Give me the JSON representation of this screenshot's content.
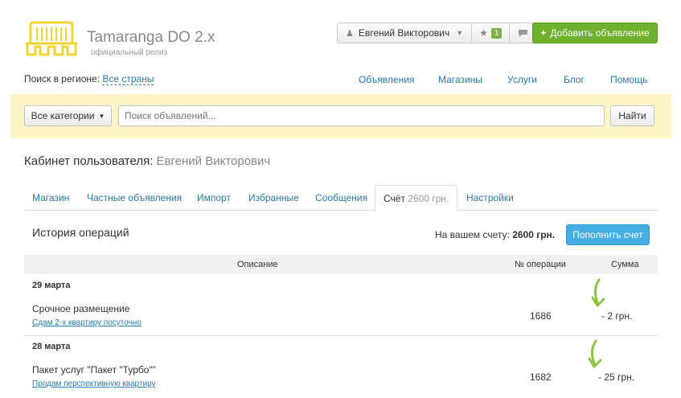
{
  "brand": {
    "title": "Tamaranga DO 2.x",
    "subtitle": "официальный релиз",
    "logo_icon": "turnstile-logo-icon",
    "logo_color": "#f2d533"
  },
  "header": {
    "user_name": "Евгений Викторович",
    "user_icon": "user-icon",
    "favorites_icon": "star-icon",
    "favorites_count": "1",
    "messages_icon": "chat-icon",
    "add_button": "Добавить объявление",
    "accent_green": "#6fb02c"
  },
  "region": {
    "label": "Поиск в регионе:",
    "value": "Все страны"
  },
  "nav": [
    "Объявления",
    "Магазины",
    "Услуги",
    "Блог",
    "Помощь"
  ],
  "search": {
    "category_label": "Все категории",
    "placeholder": "Поиск объявлений...",
    "find_button": "Найти",
    "band_color": "#fcf4c4"
  },
  "cabinet": {
    "title": "Кабинет пользователя:",
    "user": "Евгений Викторович"
  },
  "tabs": [
    {
      "label": "Магазин"
    },
    {
      "label": "Частные объявления"
    },
    {
      "label": "Импорт"
    },
    {
      "label": "Избранные"
    },
    {
      "label": "Сообщения"
    },
    {
      "label": "Счёт",
      "sub": "2600 грн.",
      "active": true
    },
    {
      "label": "Настройки"
    }
  ],
  "operations": {
    "title": "История операций",
    "balance_label": "На вашем счету:",
    "balance_value": "2600 грн.",
    "topup_button": "Пополнить счет",
    "columns": [
      "Описание",
      "№ операции",
      "Сумма"
    ],
    "rows": [
      {
        "date": "29 марта",
        "description": "Срочное размещение",
        "link": "Сдам 2-х квартиру посуточно",
        "op_number": "1686",
        "amount": "- 2 грн."
      },
      {
        "date": "28 марта",
        "description": "Пакет услуг \"Пакет \"Турбо\"\"",
        "link": "Продам перспективную квартиру",
        "op_number": "1682",
        "amount": "- 25 грн."
      }
    ]
  }
}
